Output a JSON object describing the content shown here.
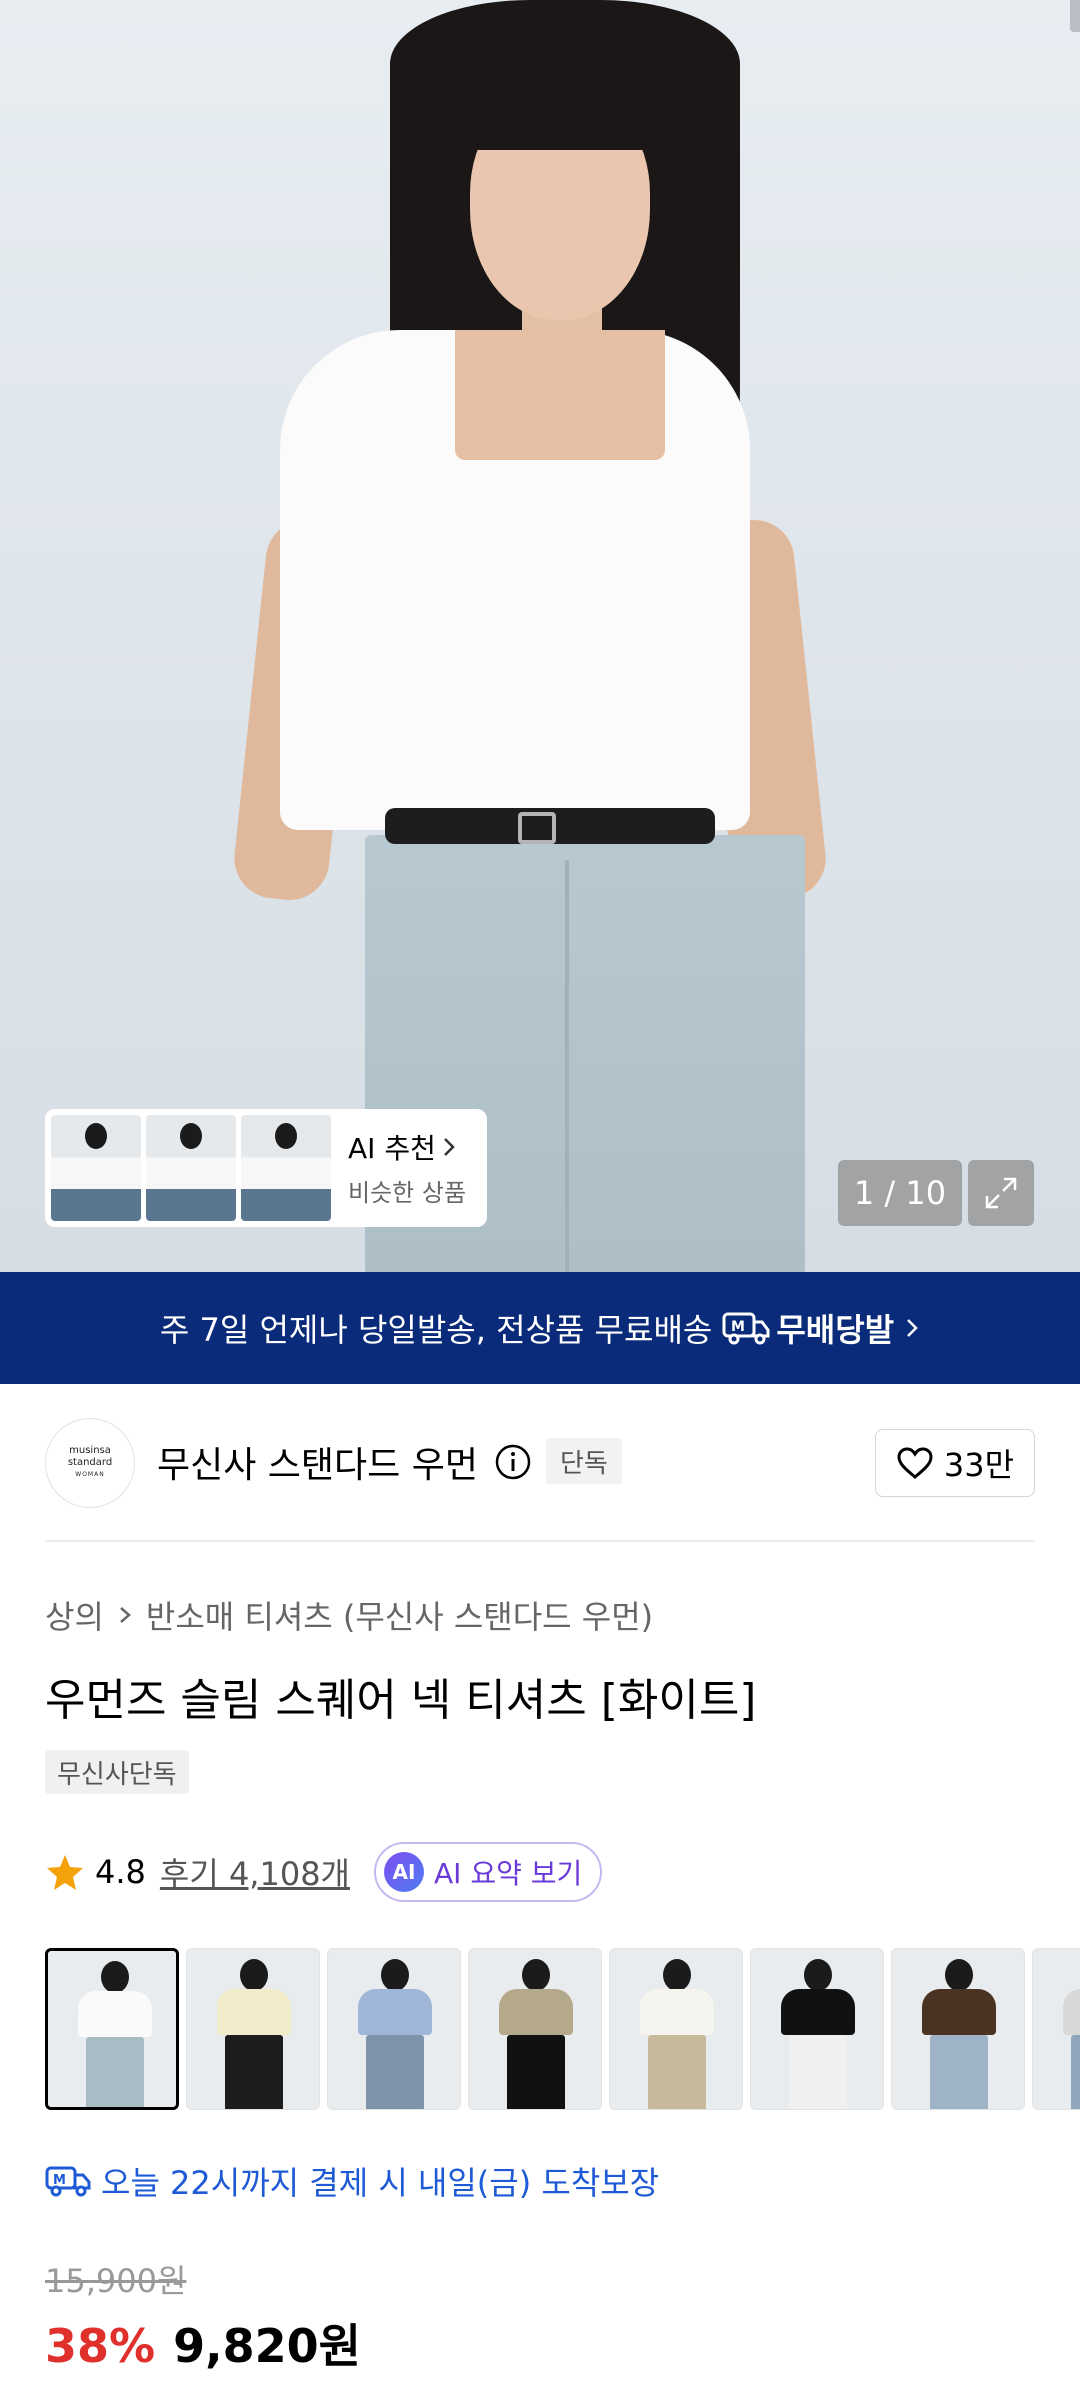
{
  "gallery": {
    "counter": "1 / 10",
    "ai_recommend": {
      "title": "AI 추천",
      "subtitle": "비슷한 상품"
    }
  },
  "banner": {
    "text": "주 7일 언제나 당일발송, 전상품 무료배송",
    "brand": "무배당발"
  },
  "brand": {
    "logo_lines": [
      "musinsa",
      "standard",
      "WOMAN"
    ],
    "name": "무신사 스탠다드 우먼",
    "tag": "단독",
    "likes": "33만"
  },
  "breadcrumb": {
    "category": "상의",
    "subcategory": "반소매 티셔츠 (무신사 스탠다드 우먼)"
  },
  "product": {
    "title": "우먼즈 슬림 스퀘어 넥 티셔츠 [화이트]",
    "exclusive_chip": "무신사단독",
    "rating": "4.8",
    "reviews": "후기 4,108개",
    "ai_summary": "AI 요약 보기",
    "ai_badge": "AI"
  },
  "variants": [
    {
      "name": "white",
      "top": "#fafafa",
      "bottom": "#a9bcc6"
    },
    {
      "name": "cream",
      "top": "#f3eccb",
      "bottom": "#1c1c1c"
    },
    {
      "name": "blue",
      "top": "#9fb6d9",
      "bottom": "#7f93a8"
    },
    {
      "name": "khaki",
      "top": "#b5a98c",
      "bottom": "#111111"
    },
    {
      "name": "ivory",
      "top": "#f6f4ee",
      "bottom": "#c7b99b"
    },
    {
      "name": "black",
      "top": "#111111",
      "bottom": "#f0f0f0"
    },
    {
      "name": "brown",
      "top": "#4a3323",
      "bottom": "#9fb3c6"
    },
    {
      "name": "extra",
      "top": "#d8d8d8",
      "bottom": "#8fa6bb"
    }
  ],
  "delivery": {
    "text": "오늘 22시까지 결제 시 내일(금) 도착보장"
  },
  "price": {
    "original": "15,900원",
    "discount": "38%",
    "sale": "9,820원"
  },
  "colors": {
    "banner": "#0a2b7a",
    "discount": "#e0302c",
    "delivery": "#1e5ad6",
    "star": "#f5a10a"
  }
}
